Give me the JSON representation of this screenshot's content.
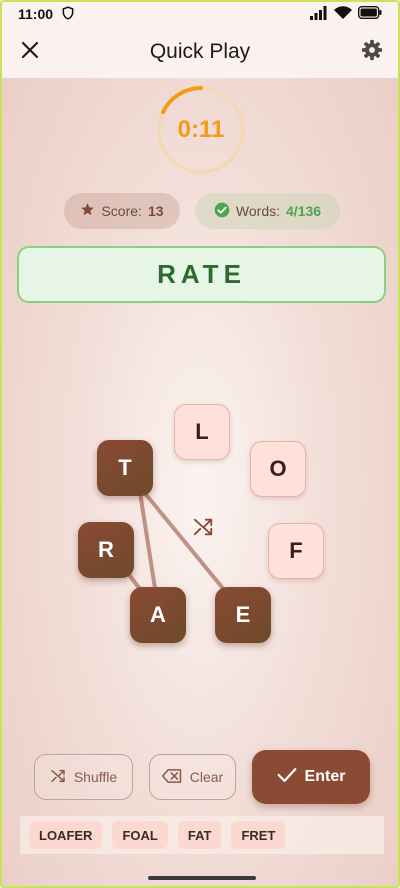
{
  "status": {
    "time": "11:00"
  },
  "appbar": {
    "title": "Quick Play"
  },
  "timer": {
    "text": "0:11",
    "progress": 0.18,
    "color": "#f39a19"
  },
  "score": {
    "label": "Score:",
    "value": "13"
  },
  "words": {
    "label": "Words:",
    "value": "4/136"
  },
  "current_word": "RATE",
  "letters": [
    {
      "letter": "L",
      "selected": false
    },
    {
      "letter": "O",
      "selected": false
    },
    {
      "letter": "F",
      "selected": false
    },
    {
      "letter": "E",
      "selected": true
    },
    {
      "letter": "A",
      "selected": true
    },
    {
      "letter": "R",
      "selected": true
    },
    {
      "letter": "T",
      "selected": true
    }
  ],
  "buttons": {
    "shuffle": "Shuffle",
    "clear": "Clear",
    "enter": "Enter"
  },
  "found_words": [
    "LOAFER",
    "FOAL",
    "FAT",
    "FRET"
  ],
  "colors": {
    "accent": "#8b4a33",
    "timer": "#f39a19",
    "success": "#4ba64e",
    "word_box_bg": "#e6f5e5"
  }
}
